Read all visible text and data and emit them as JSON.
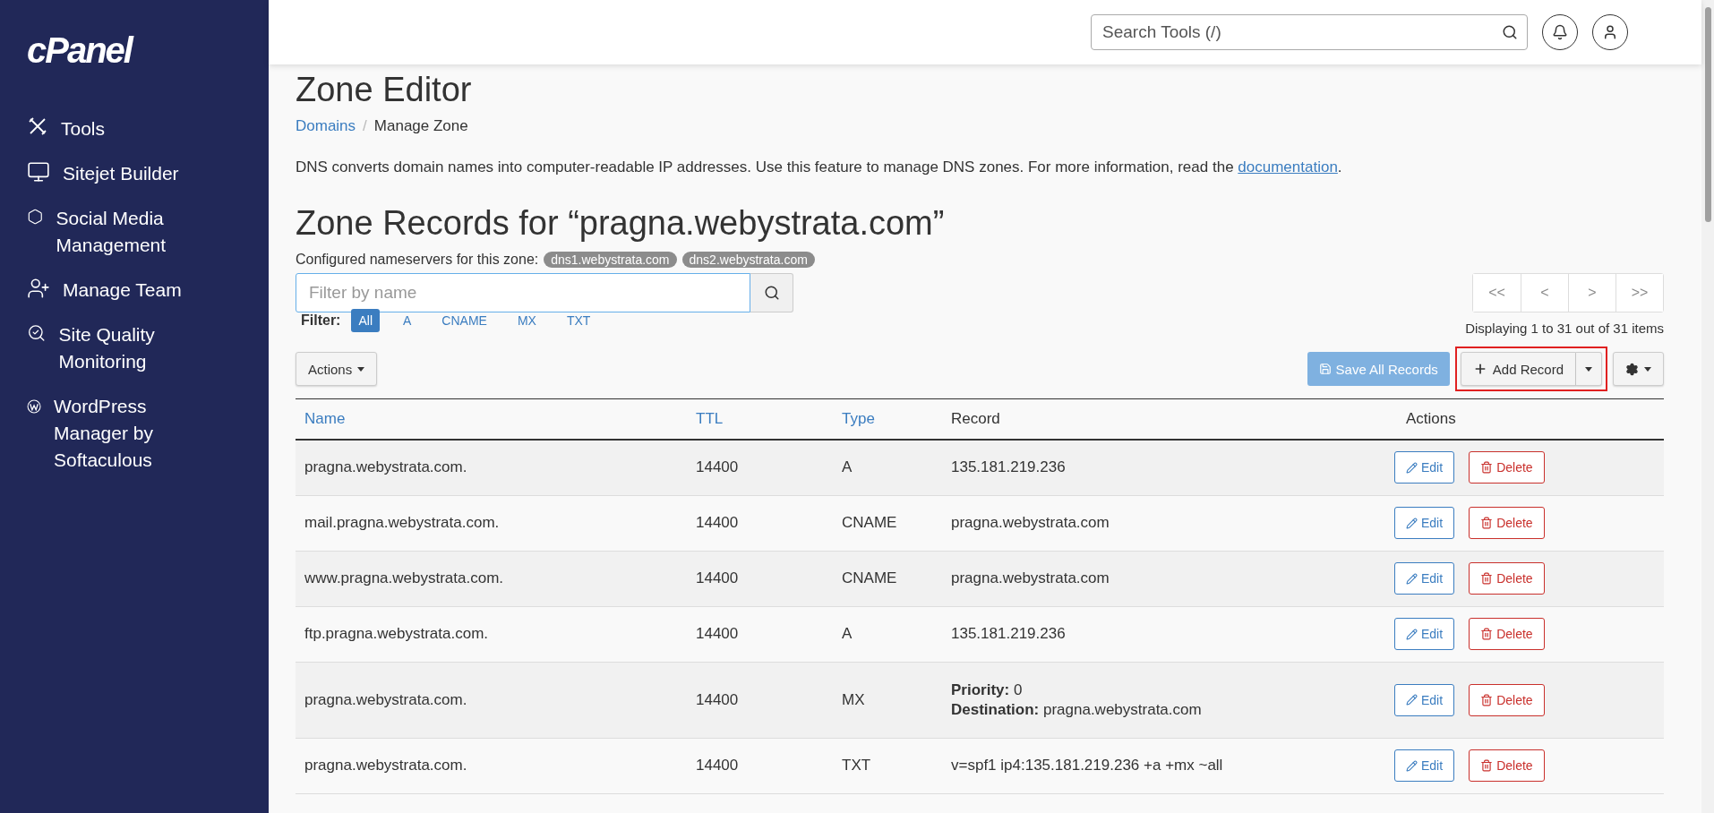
{
  "brand": {
    "logo": "cPanel"
  },
  "sidebar": {
    "items": [
      {
        "label": "Tools"
      },
      {
        "label": "Sitejet Builder"
      },
      {
        "label": "Social Media Management"
      },
      {
        "label": "Manage Team"
      },
      {
        "label": "Site Quality Monitoring"
      },
      {
        "label": "WordPress Manager by Softaculous"
      }
    ]
  },
  "search": {
    "placeholder": "Search Tools (/)"
  },
  "page_title": "Zone Editor",
  "breadcrumb": {
    "separator": "/",
    "items": [
      {
        "label": "Domains",
        "link": true
      },
      {
        "label": "Manage Zone",
        "link": false
      }
    ]
  },
  "description": {
    "text": "DNS converts domain names into computer-readable IP addresses. Use this feature to manage DNS zones. For more information, read the ",
    "link": "documentation",
    "end": "."
  },
  "zone_title": "Zone Records for “pragna.webystrata.com”",
  "nameservers": {
    "label": "Configured nameservers for this zone:",
    "servers": [
      "dns1.webystrata.com",
      "dns2.webystrata.com"
    ]
  },
  "filter_search": {
    "placeholder": "Filter by name"
  },
  "pagination": {
    "buttons": [
      "<<",
      "<",
      ">",
      ">>"
    ],
    "summary": "Displaying 1 to 31 out of 31 items"
  },
  "type_filter": {
    "label": "Filter:",
    "options": [
      {
        "label": "All",
        "selected": true
      },
      {
        "label": "A",
        "selected": false
      },
      {
        "label": "CNAME",
        "selected": false
      },
      {
        "label": "MX",
        "selected": false
      },
      {
        "label": "TXT",
        "selected": false
      }
    ]
  },
  "toolbar": {
    "actions": "Actions",
    "save": {
      "label": "Save All Records",
      "disabled": true
    },
    "add": {
      "label": "Add Record",
      "highlighted": true
    }
  },
  "table": {
    "columns": [
      {
        "label": "Name",
        "sortable": true
      },
      {
        "label": "TTL",
        "sortable": true
      },
      {
        "label": "Type",
        "sortable": true
      },
      {
        "label": "Record",
        "sortable": false
      },
      {
        "label": "Actions",
        "sortable": false
      }
    ],
    "rows": [
      {
        "name": "pragna.webystrata.com.",
        "ttl": "14400",
        "type": "A",
        "record": [
          "135.181.219.236"
        ],
        "edit": "Edit",
        "delete": "Delete"
      },
      {
        "name": "mail.pragna.webystrata.com.",
        "ttl": "14400",
        "type": "CNAME",
        "record": [
          "pragna.webystrata.com"
        ],
        "edit": "Edit",
        "delete": "Delete"
      },
      {
        "name": "www.pragna.webystrata.com.",
        "ttl": "14400",
        "type": "CNAME",
        "record": [
          "pragna.webystrata.com"
        ],
        "edit": "Edit",
        "delete": "Delete"
      },
      {
        "name": "ftp.pragna.webystrata.com.",
        "ttl": "14400",
        "type": "A",
        "record": [
          "135.181.219.236"
        ],
        "edit": "Edit",
        "delete": "Delete"
      },
      {
        "name": "pragna.webystrata.com.",
        "ttl": "14400",
        "type": "MX",
        "record": [
          "**Priority:** 0",
          "**Destination:** pragna.webystrata.com"
        ],
        "edit": "Edit",
        "delete": "Delete"
      },
      {
        "name": "pragna.webystrata.com.",
        "ttl": "14400",
        "type": "TXT",
        "record": [
          "v=spf1 ip4:135.181.219.236 +a +mx ~all"
        ],
        "edit": "Edit",
        "delete": "Delete"
      }
    ]
  }
}
